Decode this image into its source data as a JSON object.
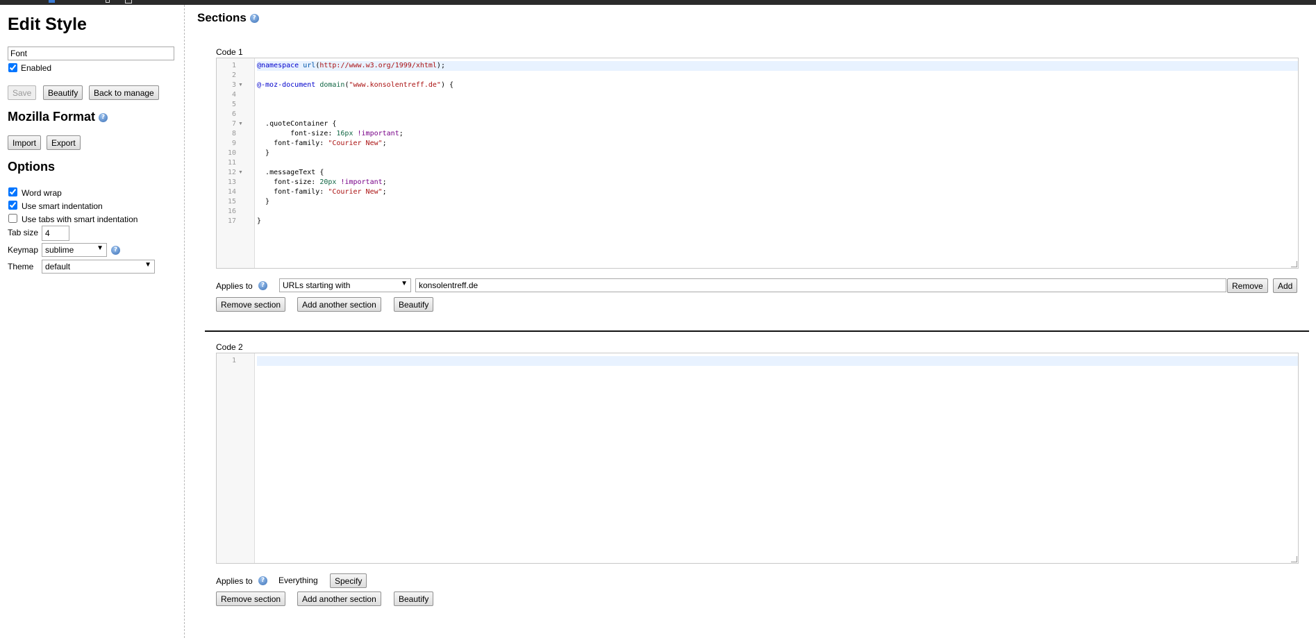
{
  "sidebar": {
    "title": "Edit Style",
    "style_name": "Font",
    "enabled_label": "Enabled",
    "enabled": true,
    "buttons": {
      "save": "Save",
      "beautify": "Beautify",
      "back": "Back to manage"
    },
    "mozilla_format": {
      "title": "Mozilla Format",
      "import": "Import",
      "export": "Export"
    },
    "options": {
      "title": "Options",
      "word_wrap": {
        "label": "Word wrap",
        "checked": true
      },
      "smart_indent": {
        "label": "Use smart indentation",
        "checked": true
      },
      "tabs_smart": {
        "label": "Use tabs with smart indentation",
        "checked": false
      },
      "tab_size_label": "Tab size",
      "tab_size": "4",
      "keymap_label": "Keymap",
      "keymap": "sublime",
      "theme_label": "Theme",
      "theme": "default"
    }
  },
  "main": {
    "title": "Sections",
    "sections": [
      {
        "label": "Code 1",
        "line_numbers": [
          "1",
          "2",
          "3",
          "4",
          "5",
          "6",
          "7",
          "8",
          "9",
          "10",
          "11",
          "12",
          "13",
          "14",
          "15",
          "16",
          "17"
        ],
        "applies_label": "Applies to",
        "applies_type": "URLs starting with",
        "applies_value": "konsolentreff.de",
        "remove_label": "Remove",
        "add_label": "Add",
        "remove_section": "Remove section",
        "add_section": "Add another section",
        "beautify": "Beautify"
      },
      {
        "label": "Code 2",
        "line_numbers": [
          "1"
        ],
        "applies_label": "Applies to",
        "applies_everything": "Everything",
        "specify": "Specify",
        "remove_section": "Remove section",
        "add_section": "Add another section",
        "beautify": "Beautify"
      }
    ]
  },
  "colors": {
    "accent": "#3a6fb5",
    "active_line": "#e8f2ff",
    "string": "#aa1111",
    "number": "#116644",
    "keyword": "#770088"
  }
}
